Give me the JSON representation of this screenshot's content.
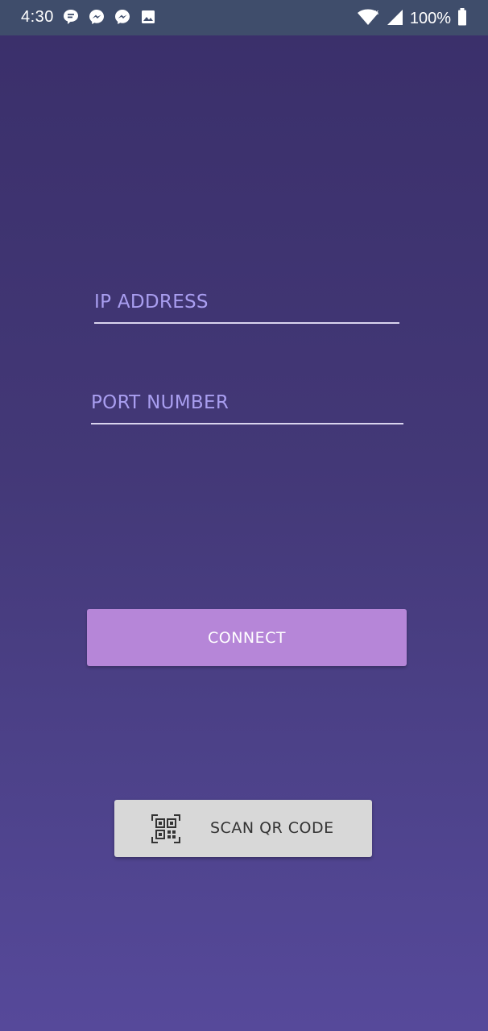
{
  "status_bar": {
    "time": "4:30",
    "battery": "100%",
    "left_icons": [
      "chat-icon",
      "messenger-icon",
      "messenger-icon",
      "gallery-icon"
    ],
    "right_icons": [
      "wifi-icon",
      "signal-icon",
      "battery-icon"
    ]
  },
  "form": {
    "ip_placeholder": "IP ADDRESS",
    "port_placeholder": "PORT NUMBER"
  },
  "buttons": {
    "connect_label": "CONNECT",
    "scan_label": "SCAN QR CODE",
    "scan_icon": "qr-code-icon"
  },
  "colors": {
    "background_top": "#3a2f6a",
    "background_bottom": "#56499a",
    "status_bar": "#3f4d6b",
    "label": "#a99ef0",
    "connect_button": "#b686d8",
    "scan_button": "#d8d8d8"
  }
}
